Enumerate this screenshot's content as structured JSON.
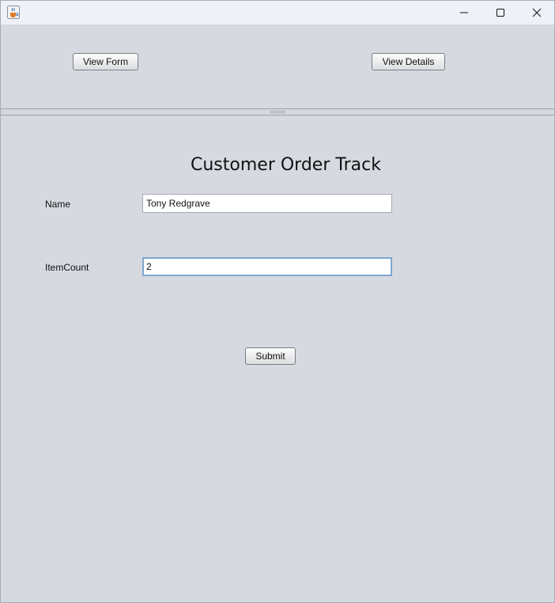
{
  "window": {
    "title": ""
  },
  "top_panel": {
    "view_form_label": "View Form",
    "view_details_label": "View Details"
  },
  "form": {
    "title": "Customer Order Track",
    "name_label": "Name",
    "name_value": "Tony Redgrave",
    "item_count_label": "ItemCount",
    "item_count_value": "2",
    "submit_label": "Submit"
  },
  "icons": {
    "app": "java-coffee-cup-icon",
    "minimize": "minimize-icon",
    "maximize": "maximize-icon",
    "close": "close-icon"
  },
  "colors": {
    "panel_background": "#d6d9e0",
    "titlebar_background": "#eef1f8",
    "focus_border": "#7ea6cf"
  }
}
